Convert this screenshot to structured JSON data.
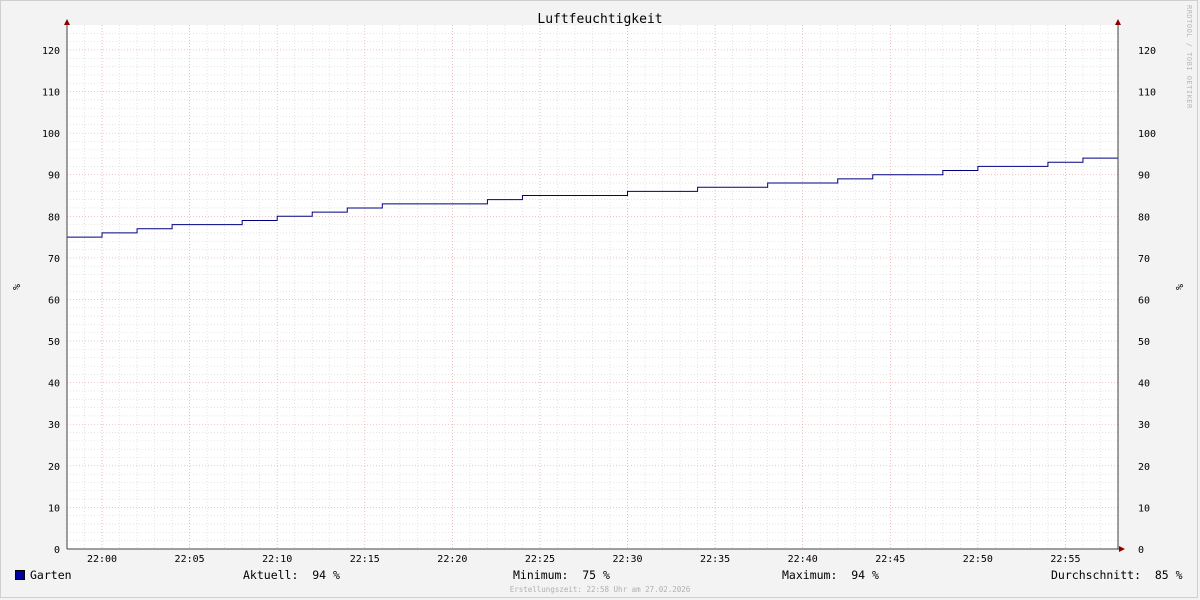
{
  "chart_data": {
    "type": "line",
    "title": "Luftfeuchtigkeit",
    "ylabel": "%",
    "ylabel_right": "%",
    "ylim": [
      0,
      126
    ],
    "yticks": [
      0,
      10,
      20,
      30,
      40,
      50,
      60,
      70,
      80,
      90,
      100,
      110,
      120
    ],
    "xlim": [
      "21:58",
      "22:58"
    ],
    "xticks": [
      "22:00",
      "22:05",
      "22:10",
      "22:15",
      "22:20",
      "22:25",
      "22:30",
      "22:35",
      "22:40",
      "22:45",
      "22:50",
      "22:55"
    ],
    "grid": true,
    "step": true,
    "series": [
      {
        "name": "Garten",
        "color": "#000080",
        "x": [
          "21:58",
          "22:00",
          "22:02",
          "22:04",
          "22:08",
          "22:10",
          "22:12",
          "22:14",
          "22:16",
          "22:22",
          "22:24",
          "22:30",
          "22:34",
          "22:38",
          "22:42",
          "22:44",
          "22:48",
          "22:50",
          "22:54",
          "22:56",
          "22:58"
        ],
        "values": [
          75,
          76,
          77,
          78,
          79,
          80,
          81,
          82,
          83,
          84,
          85,
          86,
          87,
          88,
          89,
          90,
          91,
          92,
          93,
          94,
          94
        ]
      }
    ]
  },
  "legend": {
    "series_name": "Garten",
    "swatch_color": "#0000a0",
    "current": "Aktuell:  94 %",
    "minimum": "Minimum:  75 %",
    "maximum": "Maximum:  94 %",
    "average": "Durchschnitt:  85 %"
  },
  "footer": "Erstellungszeit: 22:58 Uhr am 27.02.2026",
  "watermark": "RRDTOOL / TOBI OETIKER"
}
